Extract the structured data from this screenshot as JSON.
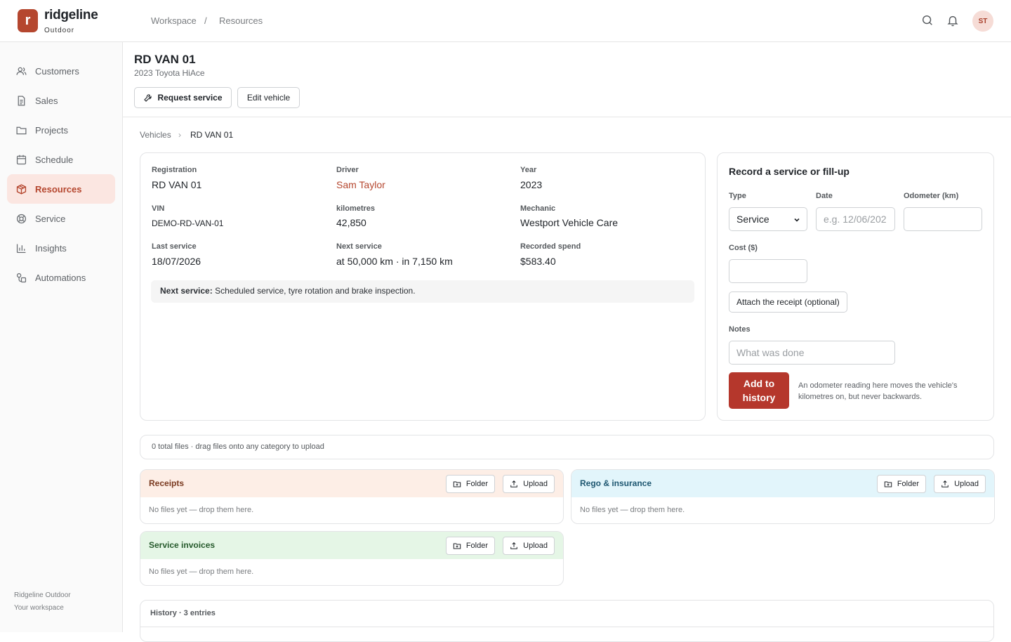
{
  "brand": {
    "logo_letter": "r",
    "name": "ridgeline",
    "sub": "Outdoor"
  },
  "top_breadcrumb": {
    "workspace": "Workspace",
    "separator": "/",
    "current": "Resources"
  },
  "user": {
    "initials": "ST"
  },
  "sidebar": {
    "items": [
      {
        "label": "Customers",
        "icon": "users-icon"
      },
      {
        "label": "Sales",
        "icon": "document-icon"
      },
      {
        "label": "Projects",
        "icon": "folder-icon"
      },
      {
        "label": "Schedule",
        "icon": "calendar-icon"
      },
      {
        "label": "Resources",
        "icon": "box-icon",
        "active": true
      },
      {
        "label": "Service",
        "icon": "lifebuoy-icon"
      },
      {
        "label": "Insights",
        "icon": "bar-chart-icon"
      },
      {
        "label": "Automations",
        "icon": "shapes-icon"
      }
    ],
    "footer": {
      "org": "Ridgeline Outdoor",
      "workspace": "Your workspace"
    }
  },
  "header": {
    "title": "RD VAN 01",
    "subtitle": "2023 Toyota HiAce",
    "request_label": "Request service",
    "edit_label": "Edit vehicle"
  },
  "breadcrumb": {
    "parent": "Vehicles",
    "chevron": "›",
    "current": "RD VAN 01"
  },
  "details": {
    "registration_label": "Registration",
    "registration": "RD VAN 01",
    "driver_label": "Driver",
    "driver": "Sam Taylor",
    "year_label": "Year",
    "year": "2023",
    "vin_label": "VIN",
    "vin": "DEMO-RD-VAN-01",
    "km_label": "kilometres",
    "km": "42,850",
    "mechanic_label": "Mechanic",
    "mechanic": "Westport Vehicle Care",
    "last_service_label": "Last service",
    "last_service": "18/07/2026",
    "next_service_label": "Next service",
    "next_service": "at 50,000 km · in 7,150 km",
    "spend_label": "Recorded spend",
    "spend": "$583.40",
    "note_prefix": "Next service:",
    "note_text": "Scheduled service, tyre rotation and brake inspection."
  },
  "record": {
    "title": "Record a service or fill-up",
    "type_label": "Type",
    "type_value": "Service",
    "date_label": "Date",
    "date_placeholder": "e.g. 12/06/202",
    "odometer_label": "Odometer (km)",
    "cost_label": "Cost ($)",
    "attach_label": "Attach the receipt (optional)",
    "notes_label": "Notes",
    "notes_placeholder": "What was done",
    "add_label_1": "Add to",
    "add_label_2": "history",
    "helper": "An odometer reading here moves the vehicle's kilometres on, but never backwards."
  },
  "files": {
    "summary": "0 total files · drag files onto any category to upload",
    "folder_label": "Folder",
    "upload_label": "Upload",
    "empty_text": "No files yet — drop them here.",
    "categories": [
      "Receipts",
      "Rego & insurance",
      "Service invoices"
    ]
  },
  "history": {
    "title": "History · 3 entries"
  },
  "colors": {
    "accent": "#b5472f",
    "primary_button": "#b5372c"
  }
}
